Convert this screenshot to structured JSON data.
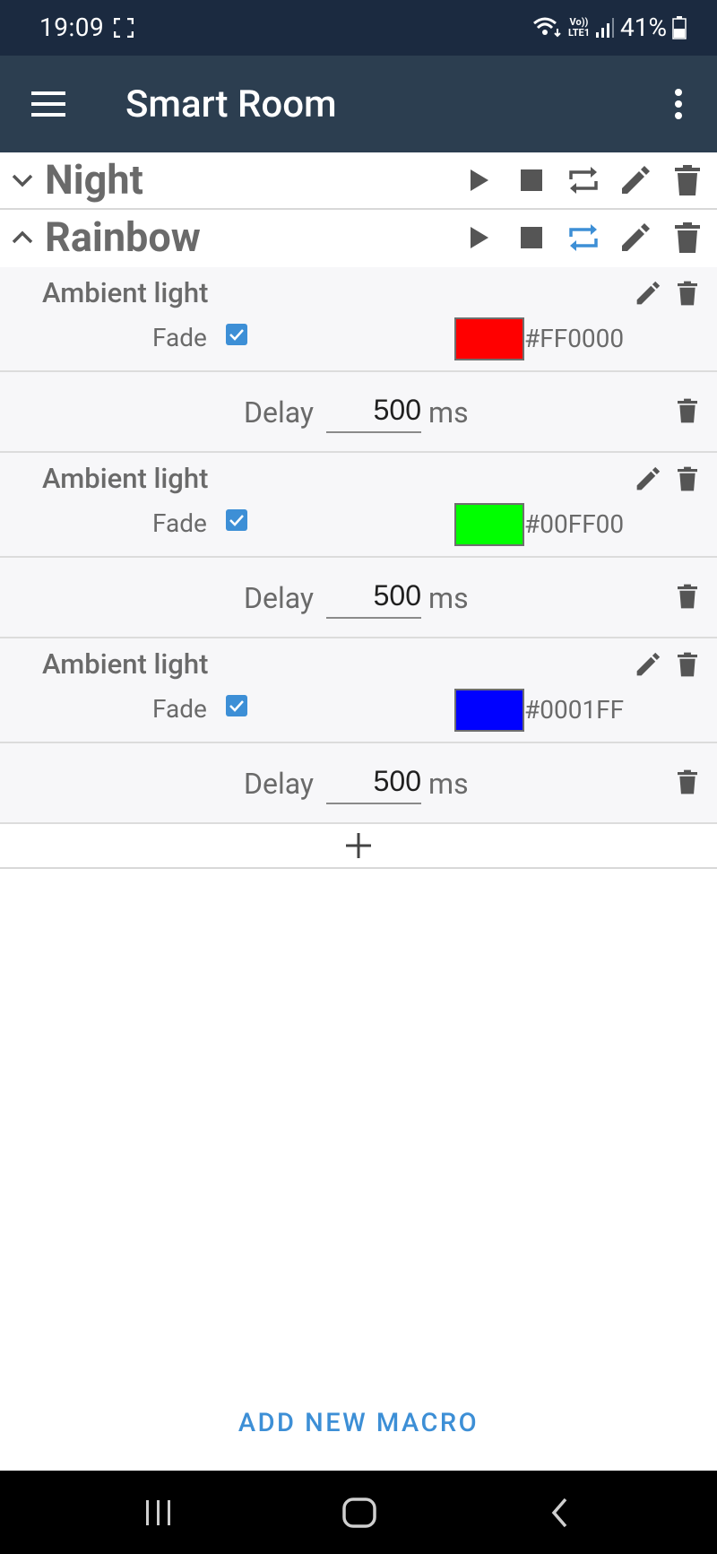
{
  "status_bar": {
    "time": "19:09",
    "battery": "41%",
    "network": "LTE1"
  },
  "app_bar": {
    "title": "Smart Room"
  },
  "macros": [
    {
      "name": "Night",
      "expanded": false,
      "repeat_active": false
    },
    {
      "name": "Rainbow",
      "expanded": true,
      "repeat_active": true,
      "steps": [
        {
          "type": "light",
          "title": "Ambient light",
          "fade_label": "Fade",
          "fade": true,
          "color": "#FF0000",
          "hex": "#FF0000"
        },
        {
          "type": "delay",
          "label": "Delay",
          "value": "500",
          "unit": "ms"
        },
        {
          "type": "light",
          "title": "Ambient light",
          "fade_label": "Fade",
          "fade": true,
          "color": "#00FF00",
          "hex": "#00FF00"
        },
        {
          "type": "delay",
          "label": "Delay",
          "value": "500",
          "unit": "ms"
        },
        {
          "type": "light",
          "title": "Ambient light",
          "fade_label": "Fade",
          "fade": true,
          "color": "#0001FF",
          "hex": "#0001FF"
        },
        {
          "type": "delay",
          "label": "Delay",
          "value": "500",
          "unit": "ms"
        }
      ]
    }
  ],
  "add_macro_label": "ADD NEW MACRO",
  "colors": {
    "status_bar": "#1b2a40",
    "app_bar": "#2c3e50",
    "accent": "#3d8fd6",
    "icon": "#555555"
  },
  "icons": {
    "menu": "menu-icon",
    "more": "more-vert-icon",
    "play": "play-icon",
    "stop": "stop-icon",
    "repeat": "repeat-icon",
    "edit": "pencil-icon",
    "delete": "trash-icon",
    "add": "plus-icon"
  }
}
